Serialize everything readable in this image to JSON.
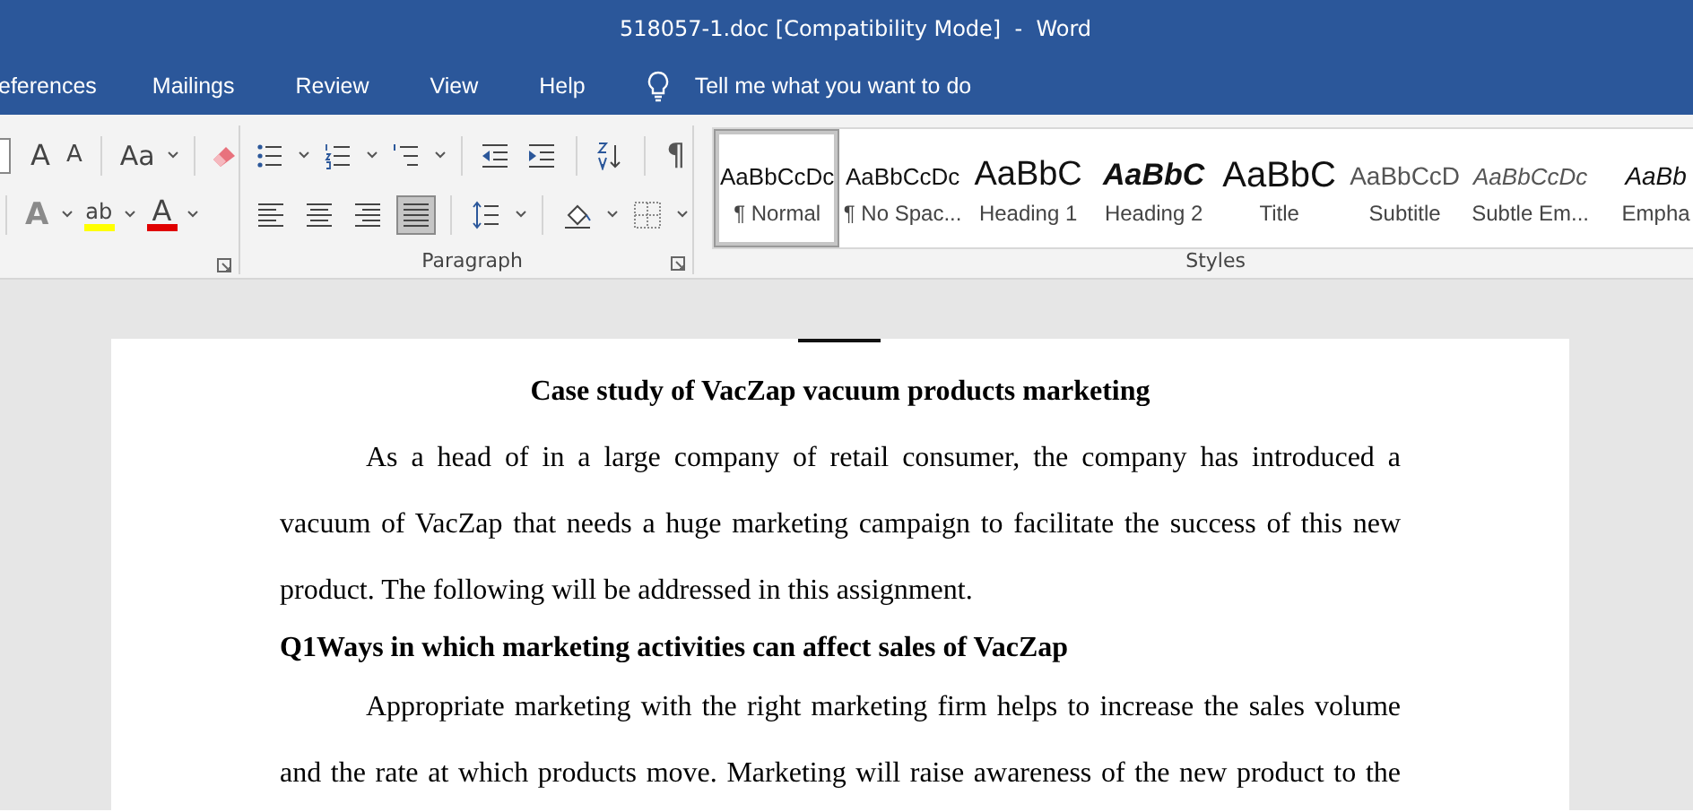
{
  "window": {
    "title": "518057-1.doc [Compatibility Mode]  -  Word"
  },
  "menu_tabs": [
    {
      "label": "eferences",
      "selected": false
    },
    {
      "label": "Mailings",
      "selected": false
    },
    {
      "label": "Review",
      "selected": false
    },
    {
      "label": "View",
      "selected": false
    },
    {
      "label": "Help",
      "selected": false
    }
  ],
  "tell_me": {
    "placeholder": "Tell me what you want to do"
  },
  "font_group": {
    "row1": [
      {
        "kind": "grow",
        "label": "A"
      },
      {
        "kind": "shrink",
        "label": "A"
      },
      {
        "kind": "case",
        "label": "Aa"
      },
      {
        "kind": "clear"
      }
    ],
    "row2": [
      {
        "kind": "effects",
        "label": "A"
      },
      {
        "kind": "highlight",
        "label": "ab",
        "color": "#ffff00"
      },
      {
        "kind": "fontcolor",
        "label": "A",
        "color": "#e00000"
      }
    ]
  },
  "paragraph_group": {
    "label": "Paragraph",
    "row1": [
      {
        "kind": "bullets"
      },
      {
        "kind": "numbering"
      },
      {
        "kind": "multilevel"
      },
      {
        "kind": "sep"
      },
      {
        "kind": "outdent"
      },
      {
        "kind": "indent"
      },
      {
        "kind": "sep"
      },
      {
        "kind": "sort"
      },
      {
        "kind": "sep"
      },
      {
        "kind": "pilcrow",
        "label": "¶"
      }
    ],
    "alignment": [
      {
        "kind": "left",
        "selected": false
      },
      {
        "kind": "center",
        "selected": false
      },
      {
        "kind": "right",
        "selected": false
      },
      {
        "kind": "justify",
        "selected": true
      }
    ],
    "row2": [
      {
        "kind": "sep"
      },
      {
        "kind": "spacing"
      },
      {
        "kind": "sep"
      },
      {
        "kind": "shading"
      },
      {
        "kind": "borders"
      }
    ]
  },
  "styles_group": {
    "label": "Styles",
    "styles": [
      {
        "kind": "normal",
        "preview": "AaBbCcDc",
        "name": "¶ Normal",
        "selected": true
      },
      {
        "kind": "normal",
        "preview": "AaBbCcDc",
        "name": "¶ No Spac...",
        "selected": false
      },
      {
        "kind": "heading1",
        "preview": "AaBbC",
        "name": "Heading 1",
        "selected": false
      },
      {
        "kind": "heading2",
        "preview": "AaBbC",
        "name": "Heading 2",
        "selected": false
      },
      {
        "kind": "title",
        "preview": "AaBbC",
        "name": "Title",
        "selected": false
      },
      {
        "kind": "subtitle",
        "preview": "AaBbCcD",
        "name": "Subtitle",
        "selected": false
      },
      {
        "kind": "subtle",
        "preview": "AaBbCcDc",
        "name": "Subtle Em...",
        "selected": false
      },
      {
        "kind": "emphasis",
        "preview": "AaBb",
        "name": "Empha",
        "selected": false
      }
    ]
  },
  "document": {
    "paragraphs": [
      {
        "kind": "title",
        "text": "Case study of VacZap vacuum products marketing"
      },
      {
        "kind": "body",
        "text": "As a head of in a large company of retail consumer, the company has introduced a vacuum of VacZap that needs a huge marketing campaign to facilitate the success of this new product. The following will be addressed in this assignment.",
        "cut_off": false
      },
      {
        "kind": "heading",
        "text": "Q1Ways in which marketing activities can affect sales of VacZap"
      },
      {
        "kind": "body",
        "text": "Appropriate marketing with the right marketing firm helps to increase the sales volume and the rate at which products move. Marketing will raise awareness of the new product to the",
        "cut_off": true
      }
    ]
  }
}
